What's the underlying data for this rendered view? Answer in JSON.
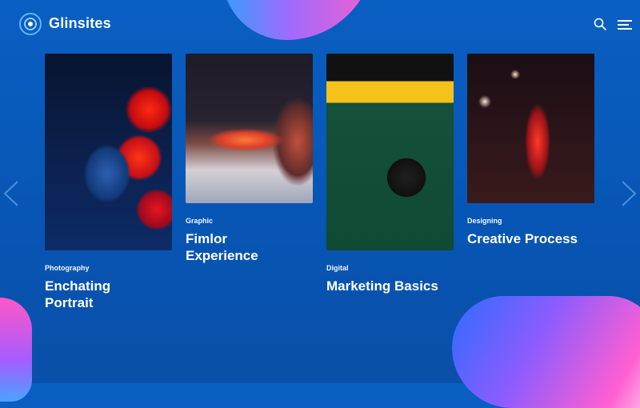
{
  "header": {
    "brand": "Glinsites",
    "search_icon": "search-icon",
    "menu_icon": "menu-icon"
  },
  "cards": [
    {
      "category": "Photography",
      "title_line1": "Enchating",
      "title_line2": "Portrait",
      "image": "portrait-photo"
    },
    {
      "category": "Graphic",
      "title_line1": "Fimlor",
      "title_line2": "Experience",
      "image": "city-night-photo"
    },
    {
      "category": "Digital",
      "title_line1": "Marketing Basics",
      "title_line2": "",
      "image": "camera-photo"
    },
    {
      "category": "Designing",
      "title_line1": "Creative Process",
      "title_line2": "",
      "image": "traffic-light-photo"
    }
  ],
  "nav": {
    "prev_icon": "chevron-left-icon",
    "next_icon": "chevron-right-icon"
  },
  "colors": {
    "background": "#0756b5",
    "accent_pink": "#ff5fd2",
    "accent_purple": "#a86bff"
  }
}
